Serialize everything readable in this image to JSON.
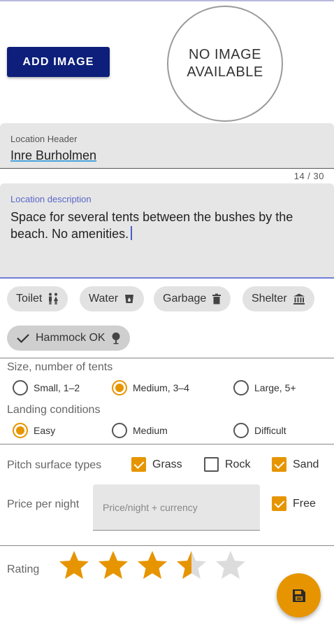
{
  "image": {
    "add_button_label": "ADD IMAGE",
    "placeholder_line1": "NO IMAGE",
    "placeholder_line2": "AVAILABLE"
  },
  "header_field": {
    "label": "Location Header",
    "value": "Inre Burholmen",
    "counter": "14 / 30"
  },
  "description_field": {
    "label": "Location description",
    "value": "Space for several tents between the bushes by the beach. No amenities."
  },
  "amenities": [
    {
      "label": "Toilet",
      "icon": "toilet-icon",
      "selected": false
    },
    {
      "label": "Water",
      "icon": "water-icon",
      "selected": false
    },
    {
      "label": "Garbage",
      "icon": "trash-icon",
      "selected": false
    },
    {
      "label": "Shelter",
      "icon": "shelter-icon",
      "selected": false
    },
    {
      "label": "Hammock OK",
      "icon": "tree-icon",
      "selected": true
    }
  ],
  "size": {
    "label": "Size, number of tents",
    "options": [
      "Small, 1–2",
      "Medium, 3–4",
      "Large, 5+"
    ],
    "selected": "Medium, 3–4"
  },
  "landing": {
    "label": "Landing conditions",
    "options": [
      "Easy",
      "Medium",
      "Difficult"
    ],
    "selected": "Easy"
  },
  "pitch": {
    "label": "Pitch surface types",
    "options": [
      {
        "label": "Grass",
        "checked": true
      },
      {
        "label": "Rock",
        "checked": false
      },
      {
        "label": "Sand",
        "checked": true
      }
    ]
  },
  "price": {
    "label": "Price per night",
    "placeholder": "Price/night + currency",
    "free_label": "Free",
    "free_checked": true
  },
  "rating": {
    "label": "Rating",
    "value": 3.5,
    "max": 5
  },
  "fab": {
    "icon": "save-icon"
  },
  "colors": {
    "accent": "#e69500",
    "primary": "#0d1f7a",
    "star_empty": "#dcdcdc"
  }
}
